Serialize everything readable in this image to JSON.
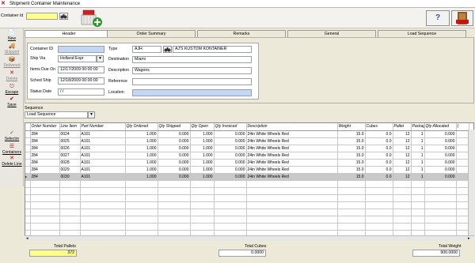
{
  "window": {
    "title": "Shipment Container Maintenance"
  },
  "top": {
    "container_id_label": "Container Id",
    "container_id_value": "",
    "help_label": "?",
    "exit_label": "Exit"
  },
  "toolbar": [
    {
      "label": "New",
      "icon": "new-icon",
      "disabled": false
    },
    {
      "label": "Shipped",
      "icon": "shipped-icon",
      "disabled": true
    },
    {
      "label": "Delivered",
      "icon": "delivered-icon",
      "disabled": true
    },
    {
      "label": "Delete",
      "icon": "delete-icon",
      "disabled": true
    },
    {
      "label": "Escape",
      "icon": "escape-icon",
      "disabled": false
    },
    {
      "label": "Save",
      "icon": "save-icon",
      "disabled": false
    },
    {
      "label": "Selector",
      "icon": "selector-icon",
      "disabled": false
    },
    {
      "label": "Containers",
      "icon": "containers-icon",
      "disabled": false
    },
    {
      "label": "Delete Line",
      "icon": "delete-line-icon",
      "disabled": false
    }
  ],
  "tabs": [
    "Header",
    "Order Summary",
    "Remarks",
    "General",
    "Load Sequence"
  ],
  "header": {
    "container_id_label": "Container ID",
    "container_id_value": "",
    "ship_via_label": "Ship Via",
    "ship_via_value": "Holland Expr",
    "items_due_on_label": "Items Due On",
    "items_due_on_value": "12/17/2009 00:00:00",
    "sched_ship_label": "Sched Ship",
    "sched_ship_value": "12/18/2009 00:00:00",
    "status_date_label": "Status Date",
    "status_date_value": "/ /",
    "type_label": "Type",
    "type_code": "AJH",
    "type_desc": "AJ'S KUSTOM KONTAINER",
    "destination_label": "Destination",
    "destination_value": "Miami",
    "description_label": "Description",
    "description_value": "Wagons",
    "reference_label": "Reference",
    "reference_value": "",
    "location_label": "Location",
    "location_value": ""
  },
  "sequence": {
    "label": "Sequence",
    "value": "Load Sequence"
  },
  "grid": {
    "columns": [
      "Order Number",
      "Line Item",
      "Part Number",
      "Qty Ordered",
      "Qty Shipped",
      "Qty Open",
      "Qty Invoiced",
      "Description",
      "Weight",
      "Cubes",
      "Pallet",
      "Packag",
      "Qty Allocated",
      "("
    ],
    "rows": [
      [
        "284",
        "0024",
        "A101",
        "1.000",
        "0.000",
        "1.000",
        "0.000",
        "24in White Wheels Red",
        "15.0",
        "0.0",
        "12",
        "1",
        "0.000"
      ],
      [
        "284",
        "0025",
        "A101",
        "1.000",
        "0.000",
        "1.000",
        "0.000",
        "24in White Wheels Red",
        "15.0",
        "0.0",
        "12",
        "1",
        "0.000"
      ],
      [
        "284",
        "0026",
        "A101",
        "1.000",
        "0.000",
        "1.000",
        "0.000",
        "24in White Wheels Red",
        "15.0",
        "0.0",
        "12",
        "1",
        "0.000"
      ],
      [
        "284",
        "0027",
        "A101",
        "1.000",
        "0.000",
        "1.000",
        "0.000",
        "24in White Wheels Red",
        "15.0",
        "0.0",
        "12",
        "1",
        "0.000"
      ],
      [
        "284",
        "0028",
        "A101",
        "1.000",
        "0.000",
        "1.000",
        "0.000",
        "24in White Wheels Red",
        "15.0",
        "0.0",
        "12",
        "1",
        "0.000"
      ],
      [
        "284",
        "0029",
        "A101",
        "1.000",
        "0.000",
        "1.000",
        "0.000",
        "24in White Wheels Red",
        "15.0",
        "0.0",
        "12",
        "1",
        "0.000"
      ],
      [
        "284",
        "0030",
        "A101",
        "1.000",
        "0.000",
        "1.000",
        "0.000",
        "24in White Wheels Red",
        "15.0",
        "0.0",
        "12",
        "1",
        "0.000"
      ]
    ],
    "selected_row": 6
  },
  "footer": {
    "total_pallets_label": "Total Pallets",
    "total_pallets_value": "372",
    "total_cubes_label": "Total Cubes",
    "total_cubes_value": "0.0000",
    "total_weight_label": "Total Weight",
    "total_weight_value": "900.0000"
  },
  "colors": {
    "highlight_yellow": "#ffff8c",
    "field_blue": "#c3d7f2",
    "selected_row": "#c9c9c9"
  }
}
